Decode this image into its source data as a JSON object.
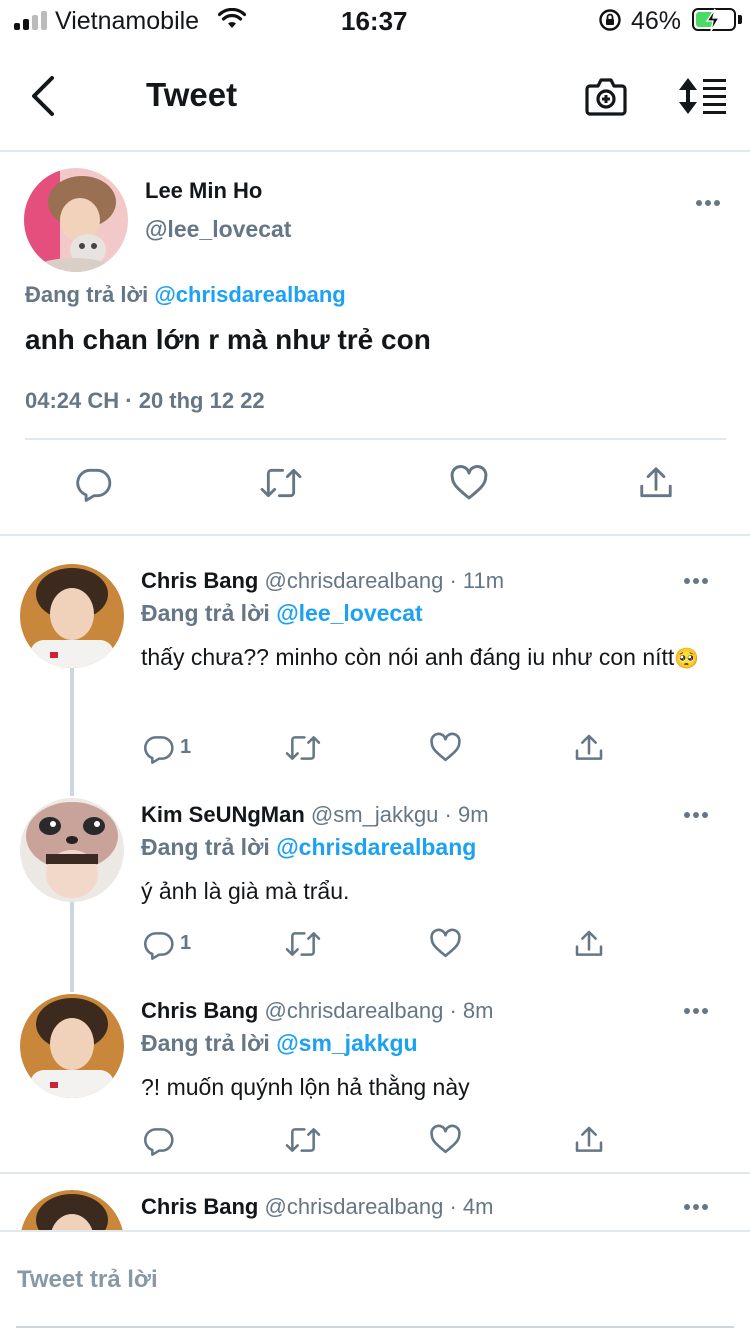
{
  "status_bar": {
    "carrier": "Vietnamobile",
    "time": "16:37",
    "battery_percent": "46%",
    "battery_level": 0.46,
    "wifi_icon": "wifi-icon",
    "lock_icon": "orientation-lock-icon"
  },
  "nav": {
    "title": "Tweet",
    "back_icon": "chevron-left-icon",
    "camera_icon": "camera-plus-icon",
    "sort_icon": "sort-icon"
  },
  "main_tweet": {
    "name": "Lee Min Ho",
    "handle": "@lee_lovecat",
    "replying_prefix": "Đang trả lời",
    "replying_to": "@chrisdarealbang",
    "text": "anh chan lớn r mà như trẻ con",
    "timestamp": "04:24 CH · 20 thg 12 22"
  },
  "replies": [
    {
      "name": "Chris Bang",
      "handle": "@chrisdarealbang · 11m",
      "replying_prefix": "Đang trả lời",
      "replying_to": "@lee_lovecat",
      "text": "thấy chưa?? minho còn nói anh đáng iu như con nítt",
      "emoji": "🥺",
      "reply_count": "1"
    },
    {
      "name": "Kim SeUNgMan",
      "handle": "@sm_jakkgu · 9m",
      "replying_prefix": "Đang trả lời",
      "replying_to": "@chrisdarealbang",
      "text": "ý ảnh là già mà trẩu.",
      "reply_count": "1"
    },
    {
      "name": "Chris Bang",
      "handle": "@chrisdarealbang · 8m",
      "replying_prefix": "Đang trả lời",
      "replying_to": "@sm_jakkgu",
      "text": "?! muốn quýnh lộn hả thằng này",
      "reply_count": ""
    },
    {
      "name": "Chris Bang",
      "handle": "@chrisdarealbang · 4m"
    }
  ],
  "compose": {
    "placeholder": "Tweet trả lời"
  },
  "colors": {
    "accent": "#1da1f2",
    "secondary_text": "#657786",
    "divider": "#e1e8ed",
    "battery_fill": "#4cd964"
  }
}
